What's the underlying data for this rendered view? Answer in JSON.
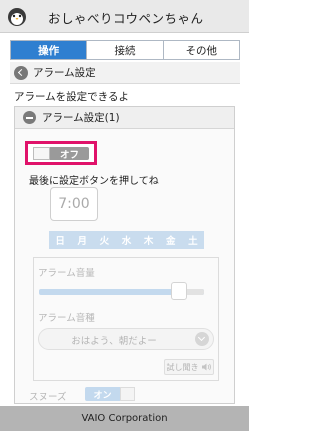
{
  "app": {
    "title": "おしゃべりコウペンちゃん"
  },
  "tabs": [
    {
      "label": "操作",
      "active": true
    },
    {
      "label": "接続",
      "active": false
    },
    {
      "label": "その他",
      "active": false
    }
  ],
  "header": {
    "back_label": "アラーム設定"
  },
  "intro_text": "アラームを設定できるよ",
  "alarm": {
    "panel_title": "アラーム設定(1)",
    "toggle_label": "オフ",
    "hint": "最後に設定ボタンを押してね",
    "time": "7:00",
    "days": [
      "日",
      "月",
      "火",
      "水",
      "木",
      "金",
      "土"
    ],
    "volume_label": "アラーム音量",
    "volume_level": 0.85,
    "sound_type_label": "アラーム音種",
    "sound_type_value": "おはよう、朝だよー",
    "preview_label": "試し聞き",
    "snooze_label": "スヌーズ",
    "snooze_toggle_label": "オン"
  },
  "footer": {
    "text": "VAIO Corporation"
  },
  "colors": {
    "accent": "#2f7fd0",
    "highlight": "#e0126a",
    "disabled_blue": "#c9dcee"
  }
}
